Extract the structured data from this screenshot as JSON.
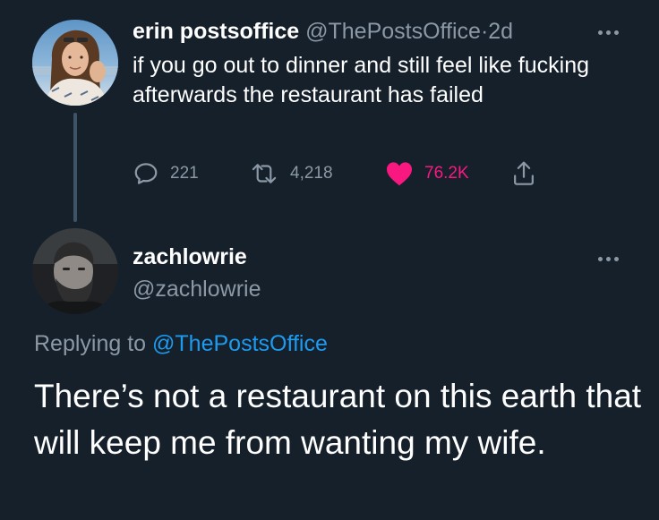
{
  "tweet1": {
    "display_name": "erin postsoffice",
    "handle": "@ThePostsOffice",
    "separator": "·",
    "time": "2d",
    "text": "if you go out to dinner and still feel like fucking afterwards the restaurant has failed",
    "replies": "221",
    "retweets": "4,218",
    "likes": "76.2K",
    "liked": true,
    "icons": {
      "reply": "speech-bubble-icon",
      "retweet": "retweet-arrows-icon",
      "like": "heart-icon",
      "share": "share-upload-icon",
      "more": "ellipsis-icon"
    }
  },
  "tweet2": {
    "display_name": "zachlowrie",
    "handle": "@zachlowrie",
    "replying_prefix": "Replying to",
    "replying_to": "@ThePostsOffice",
    "text": "There’s not a restaurant on this earth that will keep me from wanting my wife."
  },
  "colors": {
    "background": "#15202b",
    "text": "#ffffff",
    "muted": "#8b98a5",
    "link": "#1d9bf0",
    "like": "#f91880",
    "thread_line": "#3d5466"
  }
}
